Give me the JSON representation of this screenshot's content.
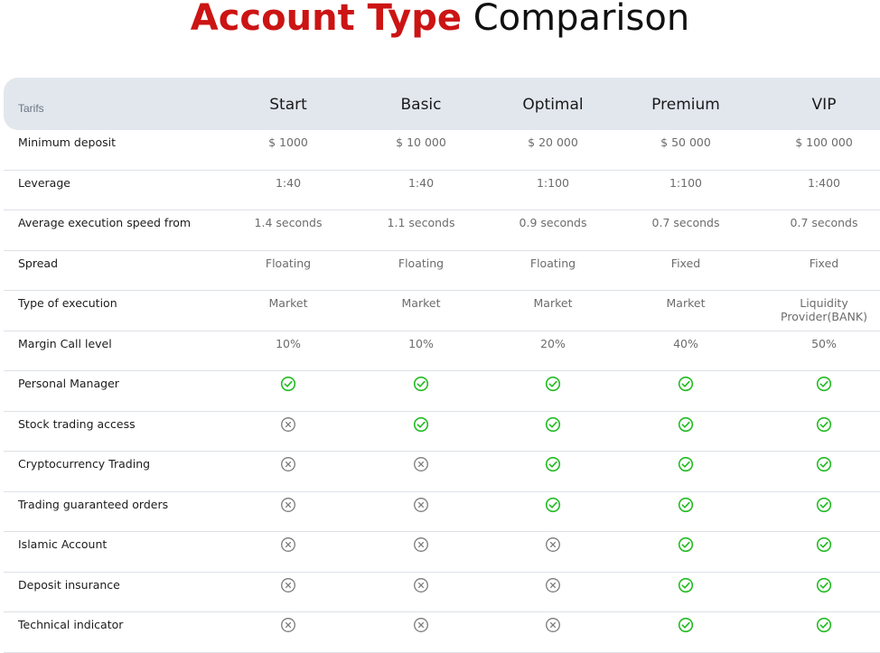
{
  "title": {
    "accent": "Account Type",
    "rest": "Comparison"
  },
  "header": {
    "tarifs_label": "Tarifs",
    "columns": [
      "Start",
      "Basic",
      "Optimal",
      "Premium",
      "VIP"
    ]
  },
  "rows": [
    {
      "label": "Minimum deposit",
      "type": "text",
      "values": [
        "$ 1000",
        "$ 10 000",
        "$ 20 000",
        "$ 50 000",
        "$ 100 000"
      ]
    },
    {
      "label": "Leverage",
      "type": "text",
      "values": [
        "1:40",
        "1:40",
        "1:100",
        "1:100",
        "1:400"
      ]
    },
    {
      "label": "Average execution speed from",
      "type": "text",
      "values": [
        "1.4 seconds",
        "1.1 seconds",
        "0.9 seconds",
        "0.7 seconds",
        "0.7 seconds"
      ]
    },
    {
      "label": "Spread",
      "type": "text",
      "values": [
        "Floating",
        "Floating",
        "Floating",
        "Fixed",
        "Fixed"
      ]
    },
    {
      "label": "Type of execution",
      "type": "text",
      "values": [
        "Market",
        "Market",
        "Market",
        "Market",
        "Liquidity Provider(BANK)"
      ]
    },
    {
      "label": "Margin Call level",
      "type": "text",
      "values": [
        "10%",
        "10%",
        "20%",
        "40%",
        "50%"
      ]
    },
    {
      "label": "Personal Manager",
      "type": "icon",
      "values": [
        true,
        true,
        true,
        true,
        true
      ]
    },
    {
      "label": "Stock trading access",
      "type": "icon",
      "values": [
        false,
        true,
        true,
        true,
        true
      ]
    },
    {
      "label": "Cryptocurrency Trading",
      "type": "icon",
      "values": [
        false,
        false,
        true,
        true,
        true
      ]
    },
    {
      "label": "Trading guaranteed orders",
      "type": "icon",
      "values": [
        false,
        false,
        true,
        true,
        true
      ]
    },
    {
      "label": "Islamic Account",
      "type": "icon",
      "values": [
        false,
        false,
        false,
        true,
        true
      ]
    },
    {
      "label": "Deposit insurance",
      "type": "icon",
      "values": [
        false,
        false,
        false,
        true,
        true
      ]
    },
    {
      "label": "Technical indicator",
      "type": "icon",
      "values": [
        false,
        false,
        false,
        true,
        true
      ]
    }
  ],
  "icons": {
    "yes": "check-circle-icon",
    "no": "x-circle-icon"
  },
  "colors": {
    "accent": "#cc1414",
    "check": "#22bb22",
    "cross": "#7a7a7a",
    "header_bg": "#e2e7ee"
  }
}
